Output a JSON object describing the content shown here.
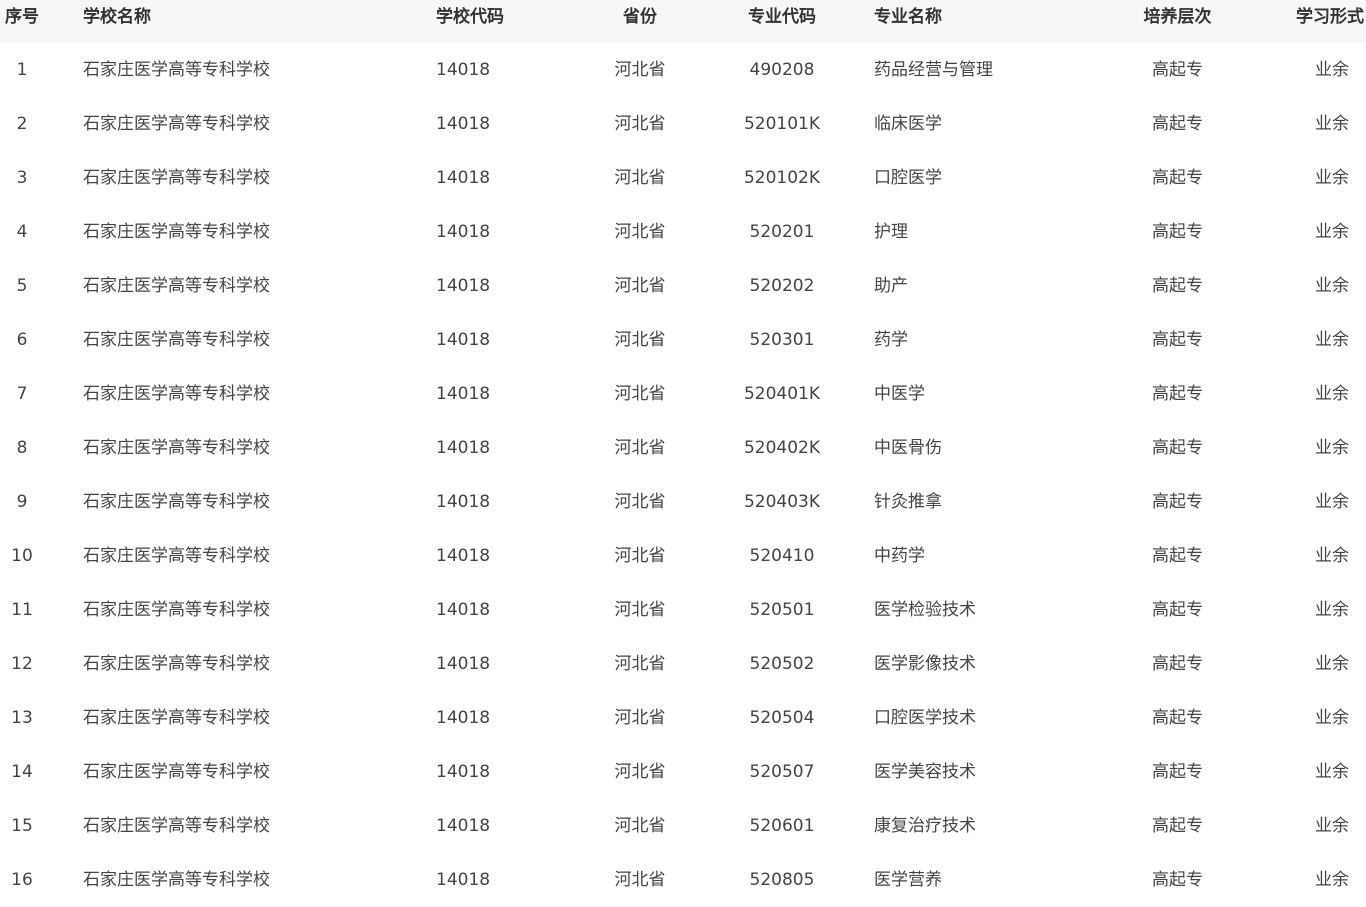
{
  "headers": {
    "idx": "序号",
    "school_name": "学校名称",
    "school_code": "学校代码",
    "province": "省份",
    "major_code": "专业代码",
    "major_name": "专业名称",
    "level": "培养层次",
    "form": "学习形式"
  },
  "rows": [
    {
      "idx": "1",
      "school_name": "石家庄医学高等专科学校",
      "school_code": "14018",
      "province": "河北省",
      "major_code": "490208",
      "major_name": "药品经营与管理",
      "level": "高起专",
      "form": "业余"
    },
    {
      "idx": "2",
      "school_name": "石家庄医学高等专科学校",
      "school_code": "14018",
      "province": "河北省",
      "major_code": "520101K",
      "major_name": "临床医学",
      "level": "高起专",
      "form": "业余"
    },
    {
      "idx": "3",
      "school_name": "石家庄医学高等专科学校",
      "school_code": "14018",
      "province": "河北省",
      "major_code": "520102K",
      "major_name": "口腔医学",
      "level": "高起专",
      "form": "业余"
    },
    {
      "idx": "4",
      "school_name": "石家庄医学高等专科学校",
      "school_code": "14018",
      "province": "河北省",
      "major_code": "520201",
      "major_name": "护理",
      "level": "高起专",
      "form": "业余"
    },
    {
      "idx": "5",
      "school_name": "石家庄医学高等专科学校",
      "school_code": "14018",
      "province": "河北省",
      "major_code": "520202",
      "major_name": "助产",
      "level": "高起专",
      "form": "业余"
    },
    {
      "idx": "6",
      "school_name": "石家庄医学高等专科学校",
      "school_code": "14018",
      "province": "河北省",
      "major_code": "520301",
      "major_name": "药学",
      "level": "高起专",
      "form": "业余"
    },
    {
      "idx": "7",
      "school_name": "石家庄医学高等专科学校",
      "school_code": "14018",
      "province": "河北省",
      "major_code": "520401K",
      "major_name": "中医学",
      "level": "高起专",
      "form": "业余"
    },
    {
      "idx": "8",
      "school_name": "石家庄医学高等专科学校",
      "school_code": "14018",
      "province": "河北省",
      "major_code": "520402K",
      "major_name": "中医骨伤",
      "level": "高起专",
      "form": "业余"
    },
    {
      "idx": "9",
      "school_name": "石家庄医学高等专科学校",
      "school_code": "14018",
      "province": "河北省",
      "major_code": "520403K",
      "major_name": "针灸推拿",
      "level": "高起专",
      "form": "业余"
    },
    {
      "idx": "10",
      "school_name": "石家庄医学高等专科学校",
      "school_code": "14018",
      "province": "河北省",
      "major_code": "520410",
      "major_name": "中药学",
      "level": "高起专",
      "form": "业余"
    },
    {
      "idx": "11",
      "school_name": "石家庄医学高等专科学校",
      "school_code": "14018",
      "province": "河北省",
      "major_code": "520501",
      "major_name": "医学检验技术",
      "level": "高起专",
      "form": "业余"
    },
    {
      "idx": "12",
      "school_name": "石家庄医学高等专科学校",
      "school_code": "14018",
      "province": "河北省",
      "major_code": "520502",
      "major_name": "医学影像技术",
      "level": "高起专",
      "form": "业余"
    },
    {
      "idx": "13",
      "school_name": "石家庄医学高等专科学校",
      "school_code": "14018",
      "province": "河北省",
      "major_code": "520504",
      "major_name": "口腔医学技术",
      "level": "高起专",
      "form": "业余"
    },
    {
      "idx": "14",
      "school_name": "石家庄医学高等专科学校",
      "school_code": "14018",
      "province": "河北省",
      "major_code": "520507",
      "major_name": "医学美容技术",
      "level": "高起专",
      "form": "业余"
    },
    {
      "idx": "15",
      "school_name": "石家庄医学高等专科学校",
      "school_code": "14018",
      "province": "河北省",
      "major_code": "520601",
      "major_name": "康复治疗技术",
      "level": "高起专",
      "form": "业余"
    },
    {
      "idx": "16",
      "school_name": "石家庄医学高等专科学校",
      "school_code": "14018",
      "province": "河北省",
      "major_code": "520805",
      "major_name": "医学营养",
      "level": "高起专",
      "form": "业余"
    }
  ],
  "colors": {
    "header_bg": "#f7f7f7",
    "header_text": "#333333",
    "body_text": "#444444"
  }
}
